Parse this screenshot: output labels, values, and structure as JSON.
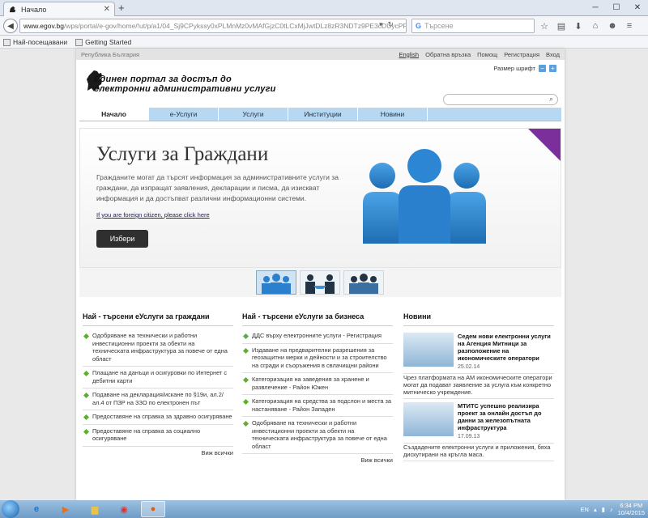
{
  "browser": {
    "tab_title": "Начало",
    "new_tab_glyph": "+",
    "url_host": "www.egov.bg",
    "url_path": "/wps/portal/e-gov/home/!ut/p/a1/04_Sj9CPykssy0xPLMnMz0vMAfGjzC0tLCxMjJwtDLz8zR3NDTz9PE3cDUycPP3djJAKI",
    "search_placeholder": "Търсене",
    "bookmarks": [
      "Най-посещавани",
      "Getting Started"
    ]
  },
  "site": {
    "country": "Република България",
    "top_links": [
      "English",
      "Обратна връзка",
      "Помощ",
      "Регистрация",
      "Вход"
    ],
    "title_line1": "Единен портал за достъп до",
    "title_line2": "електронни административни услуги",
    "font_size_label": "Размер шрифт",
    "font_minus": "−",
    "font_plus": "+",
    "menu": [
      "Начало",
      "е-Услуги",
      "Услуги",
      "Институции",
      "Новини"
    ]
  },
  "hero": {
    "heading": "Услуги за Граждани",
    "text": "Гражданите могат да търсят информация за административните услуги за граждани, да изпращат заявления, декларации и писма, да изискват информация и да достъпват различни информационни системи.",
    "foreign_link": "If you are foreign citizen, please click here",
    "button": "Избери"
  },
  "columns": {
    "citizens": {
      "heading": "Най - търсени еУслуги за граждани",
      "items": [
        "Одобряване на технически и работни инвестиционни проекти за обекти на техническата инфраструктура за повече от една област",
        "Плащане на данъци и осигуровки по Интернет с дебитни карти",
        "Подаване на декларация/искане по §19и, ал.2/ал.4 от ПЗР на ЗЗО по електронен път",
        "Предоставяне на справка за здравно осигуряване",
        "Предоставяне на справка за социално осигуряване"
      ],
      "see_all": "Виж всички"
    },
    "business": {
      "heading": "Най - търсени еУслуги за бизнеса",
      "items": [
        "ДДС върху електронните услуги - Регистрация",
        "Издаване на предварителни разрешения за геозащитни мерки и дейности и за строителство на сгради и съоръжения в свлачищни райони",
        "Категоризация на заведения за хранене и развлечение - Район Южен",
        "Категоризация на средства за подслон и места за настаняване - Район Западен",
        "Одобряване на технически и работни инвестиционни проекти за обекти на техническата инфраструктура за повече от една област"
      ],
      "see_all": "Виж всички"
    },
    "news": {
      "heading": "Новини",
      "items": [
        {
          "title": "Седем нови електронни услуги на Агенция Митници за разположение на икономическите оператори",
          "date": "25.02.14",
          "text": "Чрез платформата на АМ икономическите оператори могат да подават заявление за услуга към конкретно митническо учреждение."
        },
        {
          "title": "МТИТС успешно реализира проект за онлайн достъп до данни за железопътната инфраструктура",
          "date": "17.09.13",
          "text": "Създадените електронни услуги и приложения, бяха дискутирани на кръгла маса."
        }
      ]
    }
  },
  "taskbar": {
    "lang": "EN",
    "time": "6:34 PM",
    "date": "10/4/2015"
  }
}
